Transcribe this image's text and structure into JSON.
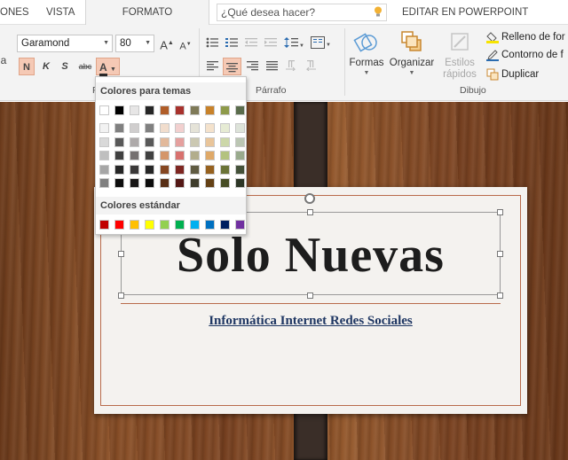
{
  "tabs": {
    "partial_left": "ONES",
    "vista": "VISTA",
    "formato": "FORMATO",
    "tell_me_placeholder": "¿Qué desea hacer?",
    "editar": "EDITAR EN POWERPOINT"
  },
  "font": {
    "name": "Garamond",
    "size": "80",
    "grow": "A",
    "shrink": "A",
    "partial_left": "a",
    "bold": "N",
    "italic": "K",
    "underline": "S",
    "strike": "abc",
    "font_color": "A",
    "group_label": "F"
  },
  "paragraph": {
    "group_label": "Párrafo"
  },
  "drawing": {
    "formas": "Formas",
    "organizar": "Organizar",
    "estilos_line1": "Estilos",
    "estilos_line2": "rápidos",
    "group_label": "Dibujo",
    "relleno": "Relleno de for",
    "contorno": "Contorno de f",
    "duplicar": "Duplicar"
  },
  "palette": {
    "theme_title": "Colores para temas",
    "standard_title": "Colores estándar",
    "theme_top": [
      "#ffffff",
      "#000000",
      "#e7e6e6",
      "#262626",
      "#b05d28",
      "#a8322d",
      "#7f7a58",
      "#c8822a",
      "#8e9a4a",
      "#5a6c4c"
    ],
    "theme_shades": [
      [
        "#f2f2f2",
        "#808080",
        "#d0cece",
        "#808080",
        "#f1ddcd",
        "#f2d0cf",
        "#e5e3d8",
        "#f4e2cc",
        "#e6ebd4",
        "#dde3d9"
      ],
      [
        "#d9d9d9",
        "#595959",
        "#aeaaaa",
        "#595959",
        "#e2b99b",
        "#e5a09e",
        "#cbc8b2",
        "#e9c59a",
        "#ccd7a9",
        "#bbc6b3"
      ],
      [
        "#bfbfbf",
        "#404040",
        "#757171",
        "#404040",
        "#d4966a",
        "#d8716e",
        "#b2ad8c",
        "#dfa968",
        "#b3c27f",
        "#99aa8d"
      ],
      [
        "#a6a6a6",
        "#262626",
        "#3a3838",
        "#262626",
        "#854621",
        "#7e2621",
        "#5f5b42",
        "#96611f",
        "#6a7337",
        "#445139"
      ],
      [
        "#7f7f7f",
        "#0d0d0d",
        "#171616",
        "#0d0d0d",
        "#582f16",
        "#541916",
        "#3f3d2c",
        "#644115",
        "#474d25",
        "#2d3626"
      ]
    ],
    "standard": [
      "#c00000",
      "#ff0000",
      "#ffc000",
      "#ffff00",
      "#92d050",
      "#00b050",
      "#00b0f0",
      "#0070c0",
      "#002060",
      "#7030a0"
    ]
  },
  "slide": {
    "title": "Solo Nuevas",
    "subtitle": "Informática  Internet Redes Sociales"
  }
}
